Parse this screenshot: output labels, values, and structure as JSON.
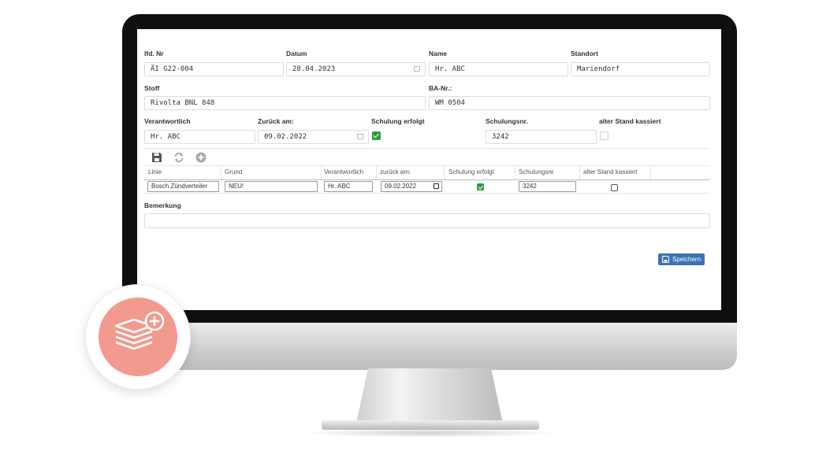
{
  "form": {
    "lfd_nr": {
      "label": "lfd. Nr",
      "value": "ÄI G22-004"
    },
    "datum": {
      "label": "Datum",
      "value": "28.04.2023"
    },
    "name": {
      "label": "Name",
      "value": "Hr. ABC"
    },
    "standort": {
      "label": "Standort",
      "value": "Mariendorf"
    },
    "stoff": {
      "label": "Stoff",
      "value": "Rivolta BNL 848"
    },
    "ba_nr": {
      "label": "BA-Nr.:",
      "value": "WM 0504"
    },
    "verantwortlich": {
      "label": "Verantwortlich",
      "value": "Hr. ABC"
    },
    "zurueck_am": {
      "label": "Zurück am:",
      "value": "09.02.2022"
    },
    "schulung_erfolgt": {
      "label": "Schulung erfolgt",
      "checked": true
    },
    "schulungsnr": {
      "label": "Schulungsnr.",
      "value": "3242"
    },
    "alter_stand": {
      "label": "alter Stand kassiert",
      "checked": false
    },
    "bemerkung": {
      "label": "Bemerkung",
      "value": ""
    }
  },
  "toolbar": {
    "icons": [
      "save-icon",
      "refresh-icon",
      "add-circle-icon"
    ]
  },
  "table": {
    "headers": [
      "Linie",
      "Grund",
      "Verantwortlich",
      "zurück am:",
      "Schulung erfolgt",
      "Schulungsnr.",
      "alter Stand kassiert"
    ],
    "rows": [
      {
        "linie": "Bosch Zündverteiler",
        "grund": "NEU!",
        "verantwortlich": "Hr. ABC",
        "zurueck_am": "09.02.2022",
        "schulung_erfolgt": true,
        "schulungsnr": "3242",
        "alter_stand": false
      }
    ]
  },
  "buttons": {
    "save_label": "Speichern"
  },
  "colors": {
    "accent": "#3a73b6",
    "check": "#2e9b46",
    "badge": "#f29a8e"
  }
}
